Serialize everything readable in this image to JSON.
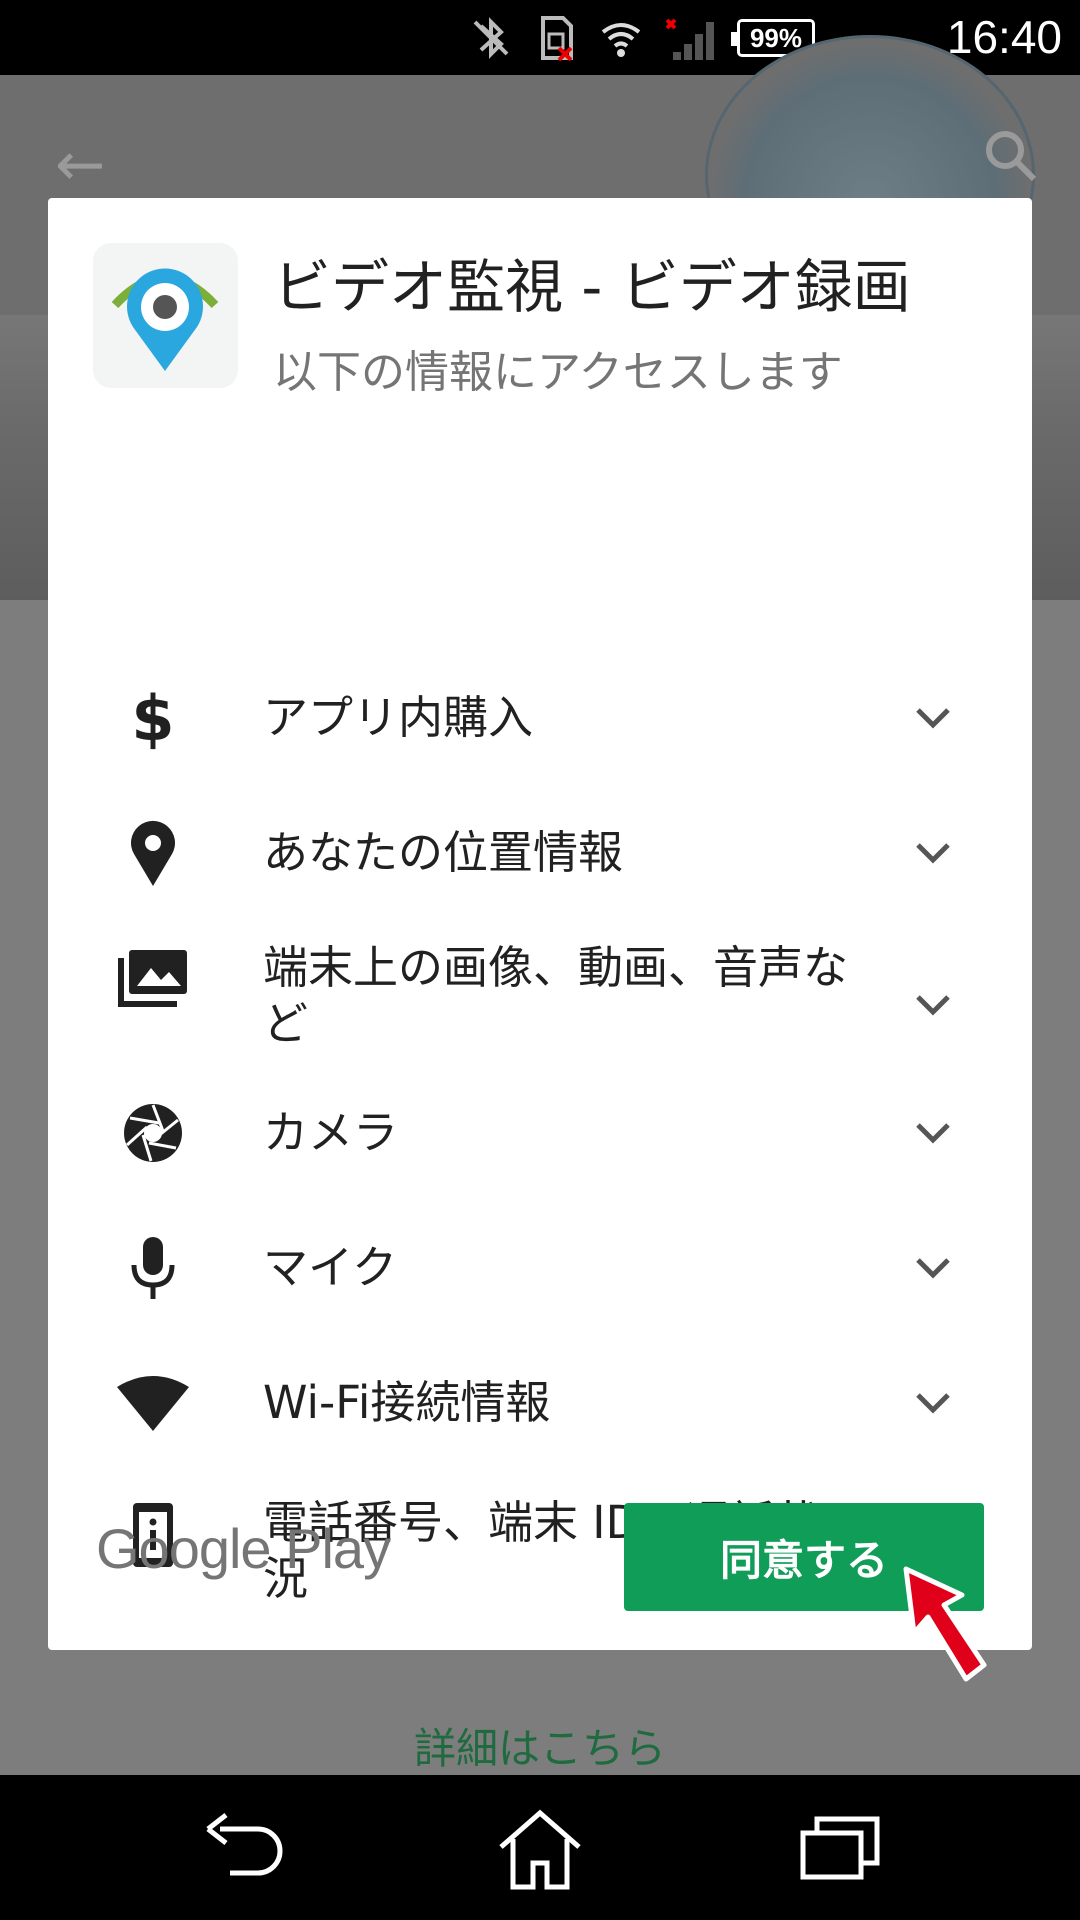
{
  "status_bar": {
    "battery": "99%",
    "time": "16:40",
    "icons": [
      "bluetooth-off-icon",
      "sim-missing-icon",
      "wifi-icon",
      "signal-icon",
      "battery-icon"
    ]
  },
  "background": {
    "details_link": "詳細はこちら"
  },
  "dialog": {
    "app_title": "ビデオ監視 - ビデオ録画",
    "subtitle": "以下の情報にアクセスします",
    "permissions": [
      {
        "label": "アプリ内購入",
        "icon": "dollar-icon"
      },
      {
        "label": "あなたの位置情報",
        "icon": "location-pin-icon"
      },
      {
        "label": "端末上の画像、動画、音声など",
        "icon": "photo-library-icon"
      },
      {
        "label": "カメラ",
        "icon": "camera-shutter-icon"
      },
      {
        "label": "マイク",
        "icon": "microphone-icon"
      },
      {
        "label": "Wi-Fi接続情報",
        "icon": "wifi-icon"
      },
      {
        "label": "電話番号、端末 ID、通話状況",
        "icon": "phone-info-icon"
      }
    ],
    "footer_logo": "Google Play",
    "agree_button": "同意する"
  },
  "colors": {
    "accent_green": "#0f9d58",
    "arrow_red": "#e0001a"
  }
}
